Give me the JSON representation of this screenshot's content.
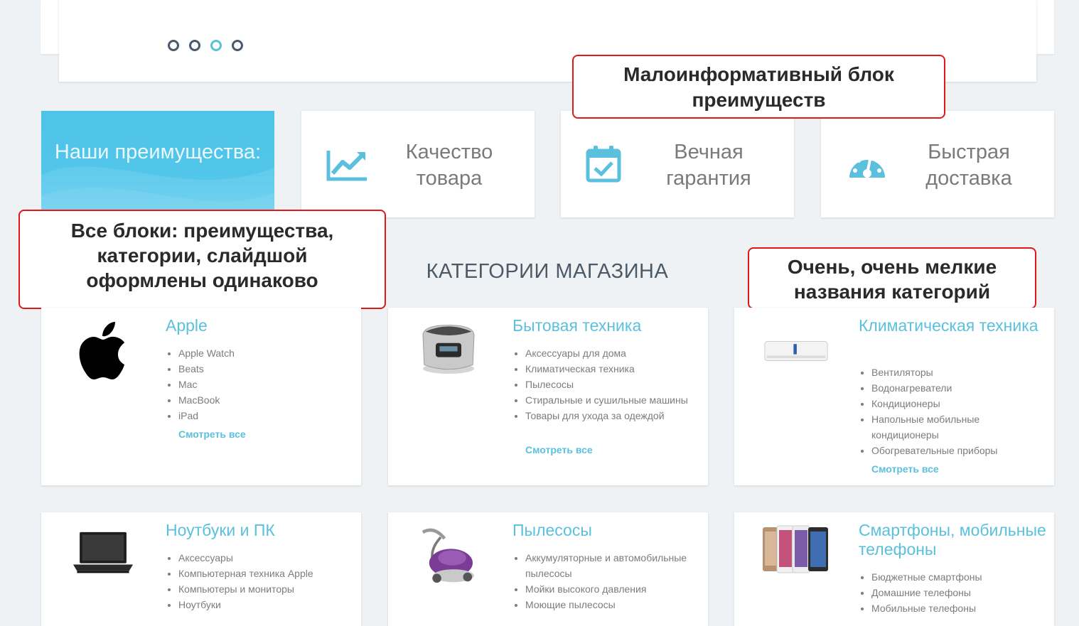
{
  "slider": {
    "dots": [
      {
        "active": false
      },
      {
        "active": false
      },
      {
        "active": true
      },
      {
        "active": false
      }
    ]
  },
  "advantages": {
    "title": "Наши преимущества:",
    "items": [
      {
        "label": "Качество товара",
        "icon": "chart-line-icon"
      },
      {
        "label": "Вечная гарантия",
        "icon": "calendar-check-icon"
      },
      {
        "label": "Быстрая доставка",
        "icon": "speedometer-icon"
      }
    ]
  },
  "callouts": {
    "advantages_note": "Малоинформативный блок преимуществ",
    "blocks_note": "Все блоки: преимущества, категории, слайдшой оформлены одинаково",
    "categories_note": "Очень, очень мелкие названия категорий"
  },
  "categories_section": {
    "title": "КАТЕГОРИИ МАГАЗИНА",
    "more_label": "Смотреть все",
    "items": [
      {
        "name": "Apple",
        "image": "apple-logo",
        "subs": [
          "Apple Watch",
          "Beats",
          "Mac",
          "MacBook",
          "iPad"
        ]
      },
      {
        "name": "Бытовая техника",
        "image": "multicooker-image",
        "subs": [
          "Аксессуары для дома",
          "Климатическая техника",
          "Пылесосы",
          "Стиральные и сушильные машины",
          "Товары для ухода за одеждой"
        ]
      },
      {
        "name": "Климатическая техника",
        "image": "air-conditioner-image",
        "subs": [
          "Вентиляторы",
          "Водонагреватели",
          "Кондиционеры",
          "Напольные мобильные кондиционеры",
          "Обогревательные приборы"
        ]
      },
      {
        "name": "Ноутбуки и ПК",
        "image": "laptop-image",
        "subs": [
          "Аксессуары",
          "Компьютерная техника Apple",
          "Компьютеры и мониторы",
          "Ноутбуки"
        ]
      },
      {
        "name": "Пылесосы",
        "image": "vacuum-cleaner-image",
        "subs": [
          "Аккумуляторные и автомобильные пылесосы",
          "Мойки высокого давления",
          "Моющие пылесосы"
        ]
      },
      {
        "name": "Смартфоны, мобильные телефоны",
        "image": "smartphones-image",
        "subs": [
          "Бюджетные смартфоны",
          "Домашние телефоны",
          "Мобильные телефоны"
        ]
      }
    ]
  },
  "colors": {
    "accent": "#5bc0de",
    "callout_border": "#e01818",
    "background": "#eff2f4"
  }
}
